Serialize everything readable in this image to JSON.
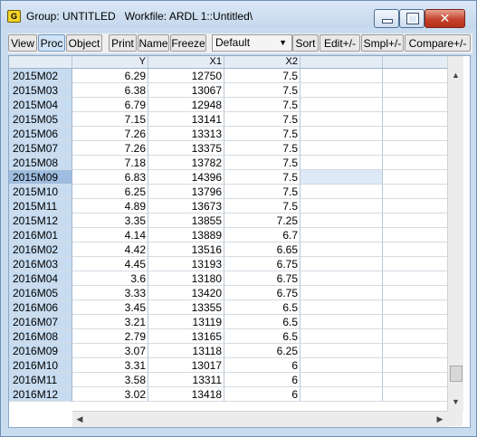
{
  "window": {
    "icon_letter": "G",
    "title": "Group: UNTITLED   Workfile: ARDL 1::Untitled\\",
    "close_glyph": "✕"
  },
  "toolbar": {
    "view": "View",
    "proc": "Proc",
    "object": "Object",
    "print": "Print",
    "name": "Name",
    "freeze": "Freeze",
    "display_format": "Default",
    "sort": "Sort",
    "edit": "Edit+/-",
    "smpl": "Smpl+/-",
    "compare": "Compare+/-"
  },
  "grid": {
    "columns": [
      "Y",
      "X1",
      "X2",
      ""
    ],
    "selected_row": "2015M09",
    "rows": [
      {
        "obs": "2015M02",
        "y": "6.29",
        "x1": "12750",
        "x2": "7.5"
      },
      {
        "obs": "2015M03",
        "y": "6.38",
        "x1": "13067",
        "x2": "7.5"
      },
      {
        "obs": "2015M04",
        "y": "6.79",
        "x1": "12948",
        "x2": "7.5"
      },
      {
        "obs": "2015M05",
        "y": "7.15",
        "x1": "13141",
        "x2": "7.5"
      },
      {
        "obs": "2015M06",
        "y": "7.26",
        "x1": "13313",
        "x2": "7.5"
      },
      {
        "obs": "2015M07",
        "y": "7.26",
        "x1": "13375",
        "x2": "7.5"
      },
      {
        "obs": "2015M08",
        "y": "7.18",
        "x1": "13782",
        "x2": "7.5"
      },
      {
        "obs": "2015M09",
        "y": "6.83",
        "x1": "14396",
        "x2": "7.5"
      },
      {
        "obs": "2015M10",
        "y": "6.25",
        "x1": "13796",
        "x2": "7.5"
      },
      {
        "obs": "2015M11",
        "y": "4.89",
        "x1": "13673",
        "x2": "7.5"
      },
      {
        "obs": "2015M12",
        "y": "3.35",
        "x1": "13855",
        "x2": "7.25"
      },
      {
        "obs": "2016M01",
        "y": "4.14",
        "x1": "13889",
        "x2": "6.7"
      },
      {
        "obs": "2016M02",
        "y": "4.42",
        "x1": "13516",
        "x2": "6.65"
      },
      {
        "obs": "2016M03",
        "y": "4.45",
        "x1": "13193",
        "x2": "6.75"
      },
      {
        "obs": "2016M04",
        "y": "3.6",
        "x1": "13180",
        "x2": "6.75"
      },
      {
        "obs": "2016M05",
        "y": "3.33",
        "x1": "13420",
        "x2": "6.75"
      },
      {
        "obs": "2016M06",
        "y": "3.45",
        "x1": "13355",
        "x2": "6.5"
      },
      {
        "obs": "2016M07",
        "y": "3.21",
        "x1": "13119",
        "x2": "6.5"
      },
      {
        "obs": "2016M08",
        "y": "2.79",
        "x1": "13165",
        "x2": "6.5"
      },
      {
        "obs": "2016M09",
        "y": "3.07",
        "x1": "13118",
        "x2": "6.25"
      },
      {
        "obs": "2016M10",
        "y": "3.31",
        "x1": "13017",
        "x2": "6"
      },
      {
        "obs": "2016M11",
        "y": "3.58",
        "x1": "13311",
        "x2": "6"
      },
      {
        "obs": "2016M12",
        "y": "3.02",
        "x1": "13418",
        "x2": "6"
      }
    ]
  },
  "scrollbars": {
    "up_glyph": "▲",
    "down_glyph": "▼",
    "left_glyph": "◀",
    "right_glyph": "▶",
    "vertical_position": 0.95
  }
}
